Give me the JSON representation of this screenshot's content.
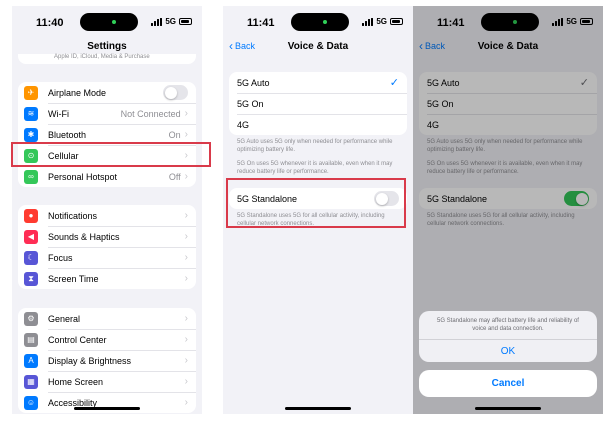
{
  "colors": {
    "accent": "#007aff",
    "toggle_on": "#34c759",
    "highlight": "#d93a4a"
  },
  "screen1": {
    "time": "11:40",
    "network": "5G",
    "title": "Settings",
    "apple_id_hint": "Apple ID, iCloud, Media & Purchase",
    "groups": [
      [
        {
          "label": "Airplane Mode",
          "icon": "airplane-icon",
          "color": "#ff9500",
          "glyph": "✈",
          "toggle": "off"
        },
        {
          "label": "Wi-Fi",
          "icon": "wifi-icon",
          "color": "#007aff",
          "glyph": "≋",
          "value": "Not Connected"
        },
        {
          "label": "Bluetooth",
          "icon": "bluetooth-icon",
          "color": "#007aff",
          "glyph": "✱",
          "value": "On"
        },
        {
          "label": "Cellular",
          "icon": "cellular-icon",
          "color": "#34c759",
          "glyph": "⊙",
          "value": ""
        },
        {
          "label": "Personal Hotspot",
          "icon": "hotspot-icon",
          "color": "#34c759",
          "glyph": "∞",
          "value": "Off"
        }
      ],
      [
        {
          "label": "Notifications",
          "icon": "notifications-icon",
          "color": "#ff3b30",
          "glyph": "●",
          "value": ""
        },
        {
          "label": "Sounds & Haptics",
          "icon": "sounds-icon",
          "color": "#ff2d55",
          "glyph": "◀",
          "value": ""
        },
        {
          "label": "Focus",
          "icon": "focus-icon",
          "color": "#5856d6",
          "glyph": "☾",
          "value": ""
        },
        {
          "label": "Screen Time",
          "icon": "screen-time-icon",
          "color": "#5856d6",
          "glyph": "⧗",
          "value": ""
        }
      ],
      [
        {
          "label": "General",
          "icon": "gear-icon",
          "color": "#8e8e93",
          "glyph": "⚙",
          "value": ""
        },
        {
          "label": "Control Center",
          "icon": "control-center-icon",
          "color": "#8e8e93",
          "glyph": "▤",
          "value": ""
        },
        {
          "label": "Display & Brightness",
          "icon": "display-icon",
          "color": "#007aff",
          "glyph": "A",
          "value": ""
        },
        {
          "label": "Home Screen",
          "icon": "home-screen-icon",
          "color": "#5856d6",
          "glyph": "▦",
          "value": ""
        },
        {
          "label": "Accessibility",
          "icon": "accessibility-icon",
          "color": "#007aff",
          "glyph": "☺",
          "value": ""
        }
      ]
    ]
  },
  "screen2": {
    "time": "11:41",
    "network": "5G",
    "back": "Back",
    "title": "Voice & Data",
    "options": [
      {
        "label": "5G Auto",
        "selected": true
      },
      {
        "label": "5G On",
        "selected": false
      },
      {
        "label": "4G",
        "selected": false
      }
    ],
    "check": "✓",
    "note1": "5G Auto uses 5G only when needed for performance while optimizing battery life.",
    "note2": "5G On uses 5G whenever it is available, even when it may reduce battery life or performance.",
    "standalone_label": "5G Standalone",
    "standalone_toggle": "off",
    "standalone_note": "5G Standalone uses 5G for all cellular activity, including cellular network connections."
  },
  "screen3": {
    "time": "11:41",
    "network": "5G",
    "back": "Back",
    "title": "Voice & Data",
    "options": [
      {
        "label": "5G Auto",
        "selected": true
      },
      {
        "label": "5G On",
        "selected": false
      },
      {
        "label": "4G",
        "selected": false
      }
    ],
    "check": "✓",
    "note1": "5G Auto uses 5G only when needed for performance while optimizing battery life.",
    "note2": "5G On uses 5G whenever it is available, even when it may reduce battery life or performance.",
    "standalone_label": "5G Standalone",
    "standalone_toggle": "on",
    "standalone_note": "5G Standalone uses 5G for all cellular activity, including cellular network connections.",
    "alert_message": "5G Standalone may affect battery life and reliability of voice and data connection.",
    "alert_ok": "OK",
    "alert_cancel": "Cancel"
  }
}
